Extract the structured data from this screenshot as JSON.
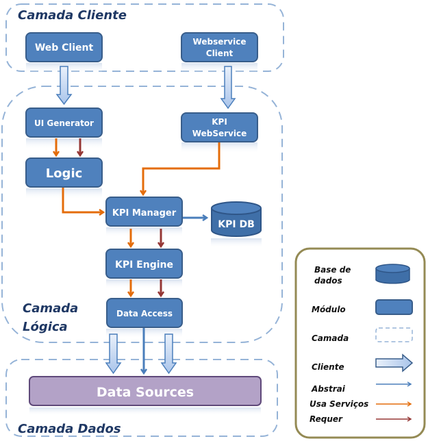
{
  "layers": {
    "client": "Camada Cliente",
    "logic_line1": "Camada",
    "logic_line2": "Lógica",
    "data": "Camada Dados"
  },
  "modules": {
    "web_client": "Web Client",
    "ws_client_line1": "Webservice",
    "ws_client_line2": "Client",
    "ui_generator": "UI Generator",
    "kpi_ws_line1": "KPI",
    "kpi_ws_line2": "WebService",
    "logic": "Logic",
    "kpi_manager": "KPI Manager",
    "kpi_db": "KPI DB",
    "kpi_engine": "KPI Engine",
    "data_access": "Data Access",
    "data_sources": "Data Sources"
  },
  "legend": {
    "database_line1": "Base de",
    "database_line2": "dados",
    "module": "Módulo",
    "layer": "Camada",
    "client": "Cliente",
    "abstracts": "Abstrai",
    "uses_services": "Usa Serviços",
    "requires": "Requer"
  },
  "colors": {
    "module_fill": "#4f81bd",
    "module_stroke": "#385d8a",
    "layer_dash": "#95b3d7",
    "abstracts": "#4a7ebb",
    "uses_services": "#e46c0a",
    "requires": "#953735",
    "data_sources_fill": "#b3a2c7",
    "legend_border": "#948a54"
  }
}
